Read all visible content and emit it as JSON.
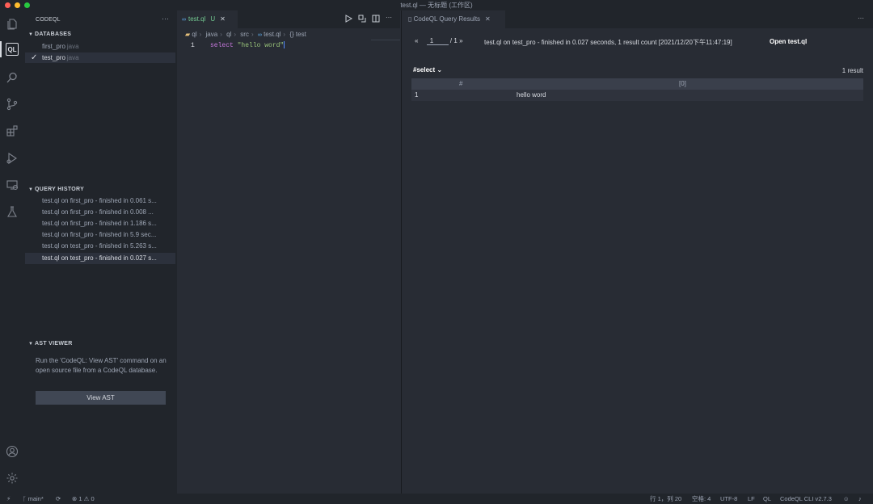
{
  "window": {
    "title": "test.ql — 无标题 (工作区)"
  },
  "colors": {
    "traffic_red": "#ff5f57",
    "traffic_yellow": "#febc2e",
    "traffic_green": "#28c840",
    "accent": "#528bff",
    "keyword": "#c678dd",
    "string": "#98c379",
    "untracked": "#73c991"
  },
  "activity_bar": {
    "icons": [
      "files-icon",
      "codeql-icon",
      "search-icon",
      "source-control-icon",
      "extensions-icon",
      "run-debug-icon",
      "remote-explorer-icon",
      "testing-icon",
      "account-icon",
      "settings-gear-icon"
    ],
    "codeql_label": "QL"
  },
  "sidebar": {
    "title": "CODEQL",
    "more": "···",
    "databases": {
      "label": "DATABASES",
      "items": [
        {
          "name": "first_pro",
          "lang": "java",
          "selected": false
        },
        {
          "name": "test_pro",
          "lang": "java",
          "selected": true
        }
      ]
    },
    "query_history": {
      "label": "QUERY HISTORY",
      "items": [
        "test.ql on first_pro - finished in 0.061 s...",
        "test.ql on first_pro - finished in 0.008 ...",
        "test.ql on first_pro - finished in 1.186 s...",
        "test.ql on first_pro - finished in 5.9 sec...",
        "test.ql on test_pro - finished in 5.263 s...",
        "test.ql on test_pro - finished in 0.027 s..."
      ]
    },
    "ast_viewer": {
      "label": "AST VIEWER",
      "text": "Run the 'CodeQL: View AST' command on an open source file from a CodeQL database.",
      "button": "View AST"
    }
  },
  "editor": {
    "tab": {
      "name": "test.ql",
      "status": "U",
      "close": "✕"
    },
    "more": "···",
    "breadcrumb": [
      "ql",
      "java",
      "ql",
      "src",
      "test.ql",
      "{} test"
    ],
    "lines": [
      {
        "number": "1",
        "keyword": "select",
        "string": "\"hello word\""
      }
    ]
  },
  "results": {
    "tab": {
      "name": "CodeQL Query Results",
      "close": "✕"
    },
    "more": "···",
    "pager": {
      "prev": "«",
      "page": "1",
      "total": "/ 1",
      "next": "»"
    },
    "status": "test.ql on test_pro - finished in 0.027 seconds, 1 result count [2021/12/20下午11:47:19]",
    "open_file": "Open test.ql",
    "select_dropdown": "#select",
    "result_count": "1 result",
    "table": {
      "headers": [
        "#",
        "[0]"
      ],
      "rows": [
        {
          "index": "1",
          "value": "hello word"
        }
      ]
    }
  },
  "status_bar": {
    "branch": "main*",
    "errors": "1",
    "warnings": "0",
    "position": "行 1，列 20",
    "spaces": "空格: 4",
    "encoding": "UTF-8",
    "eol": "LF",
    "language": "QL",
    "cli": "CodeQL CLI v2.7.3"
  }
}
